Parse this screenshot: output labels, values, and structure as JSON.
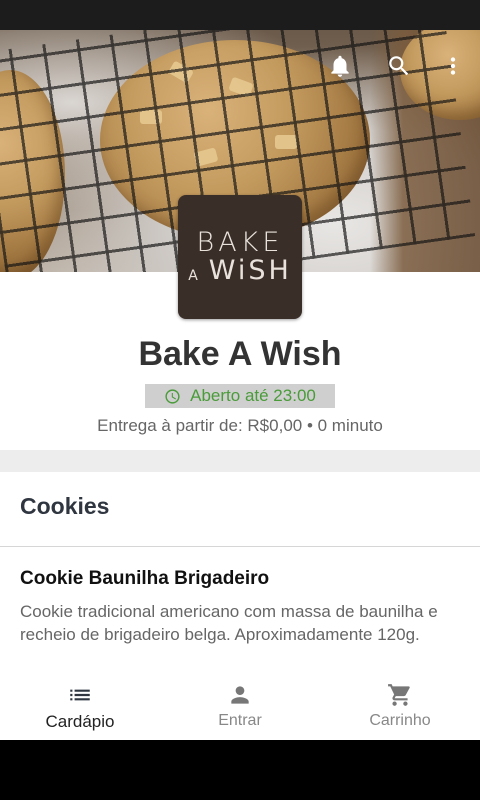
{
  "store": {
    "logo_line1": "BAKE",
    "logo_a": "A",
    "logo_line2": "WiSH",
    "name": "Bake A Wish",
    "open_status": "Aberto até 23:00",
    "delivery_info": "Entrega à partir de: R$0,00 • 0 minuto"
  },
  "header_icons": [
    "bell-icon",
    "search-icon",
    "more-vert-icon"
  ],
  "menu": {
    "section_title": "Cookies",
    "items": [
      {
        "name": "Cookie Baunilha Brigadeiro",
        "description": "Cookie tradicional americano com massa de baunilha e recheio de brigadeiro belga. Aproximadamente 120g."
      }
    ]
  },
  "bottom_nav": [
    {
      "label": "Cardápio",
      "icon": "list-icon",
      "active": true
    },
    {
      "label": "Entrar",
      "icon": "person-icon",
      "active": false
    },
    {
      "label": "Carrinho",
      "icon": "cart-icon",
      "active": false
    }
  ],
  "colors": {
    "open_green": "#4a9b3a",
    "badge_bg": "#cfcfcf",
    "logo_bg": "#3a2e28"
  }
}
